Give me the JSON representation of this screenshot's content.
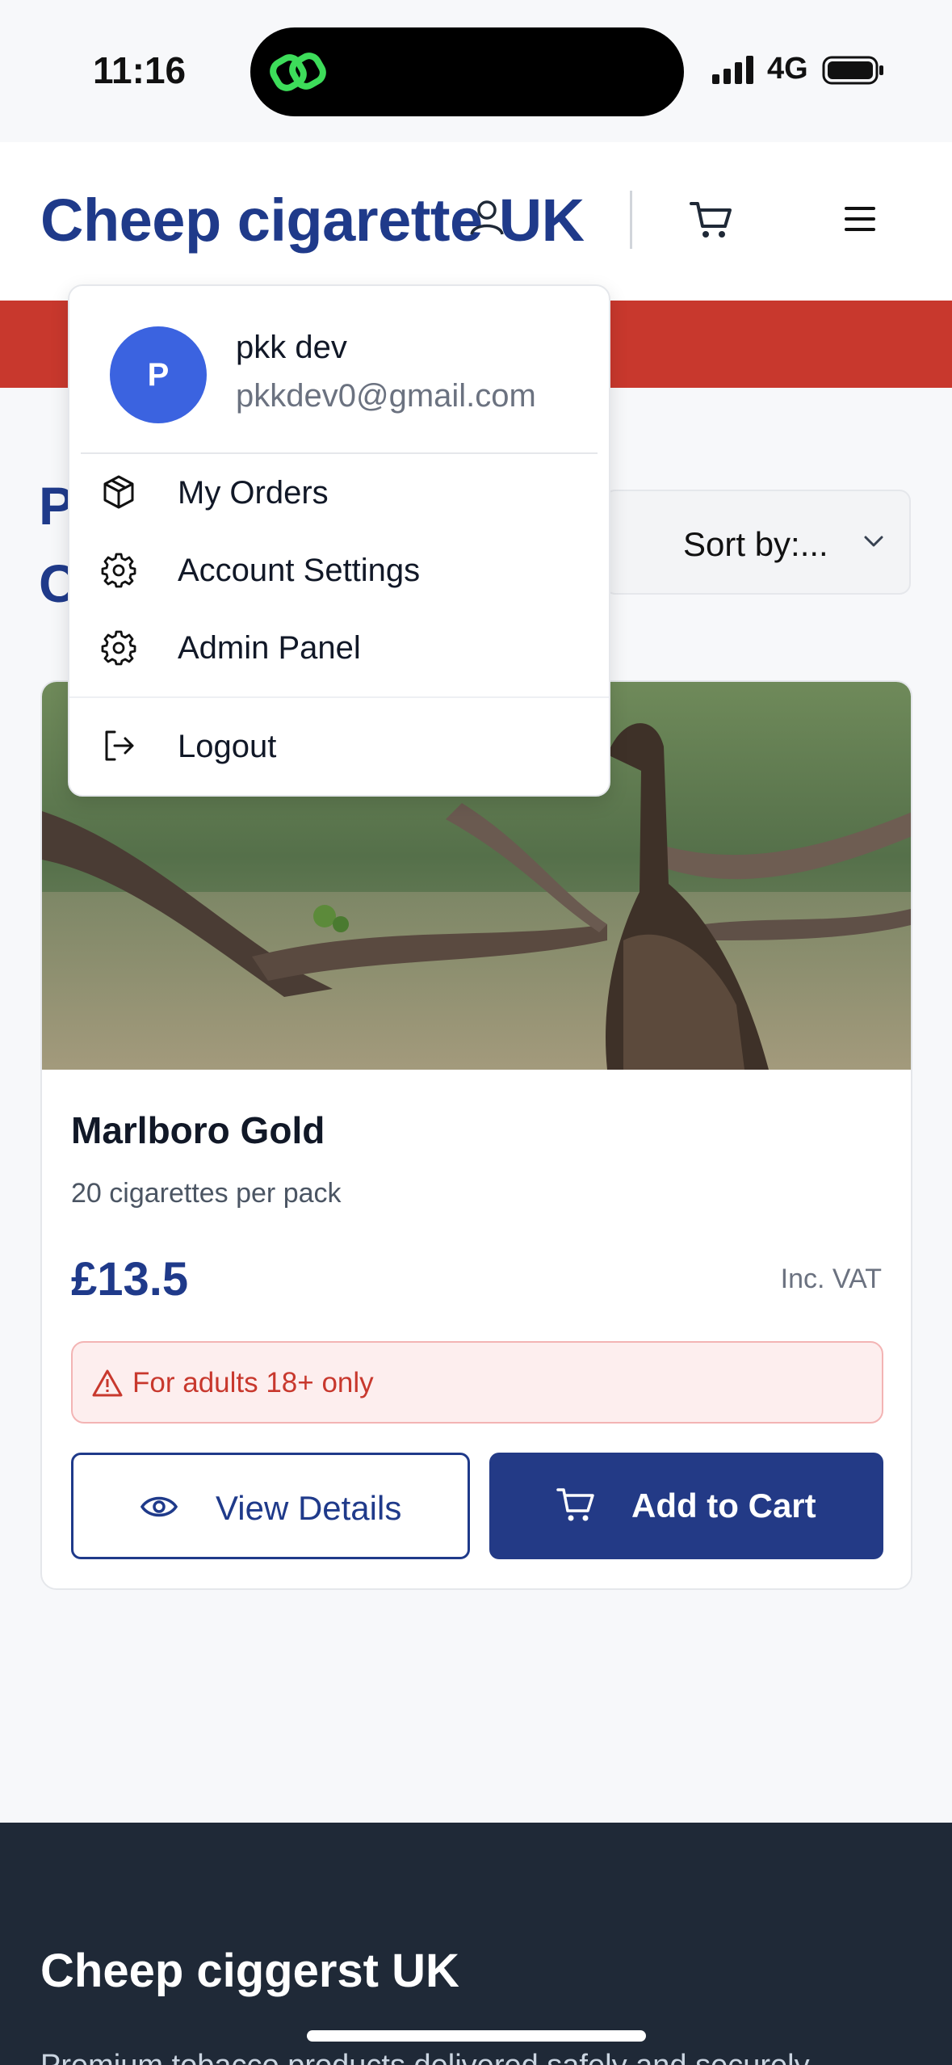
{
  "status_bar": {
    "time": "11:16",
    "network": "4G"
  },
  "header": {
    "brand": "Cheep cigarette UK"
  },
  "page": {
    "heading_line1": "P",
    "heading_line2": "C",
    "sort_label": "Sort by:..."
  },
  "product": {
    "name": "Marlboro Gold",
    "description": "20 cigarettes per pack",
    "price": "£13.5",
    "vat_note": "Inc. VAT",
    "age_warning": "For adults 18+ only",
    "view_button": "View Details",
    "cart_button": "Add to Cart"
  },
  "user_menu": {
    "avatar_initial": "P",
    "name": "pkk dev",
    "email": "pkkdev0@gmail.com",
    "items": [
      {
        "label": "My Orders",
        "icon": "package-icon"
      },
      {
        "label": "Account Settings",
        "icon": "gear-icon"
      },
      {
        "label": "Admin Panel",
        "icon": "gear-icon"
      },
      {
        "label": "Logout",
        "icon": "logout-icon"
      }
    ]
  },
  "footer": {
    "title": "Cheep ciggerst UK",
    "text": "Premium tobacco products delivered safely and securely"
  },
  "colors": {
    "brand_blue": "#1f3a8a",
    "banner_red": "#c8382d",
    "avatar_blue": "#3b63e0",
    "footer_bg": "#1f2937"
  }
}
